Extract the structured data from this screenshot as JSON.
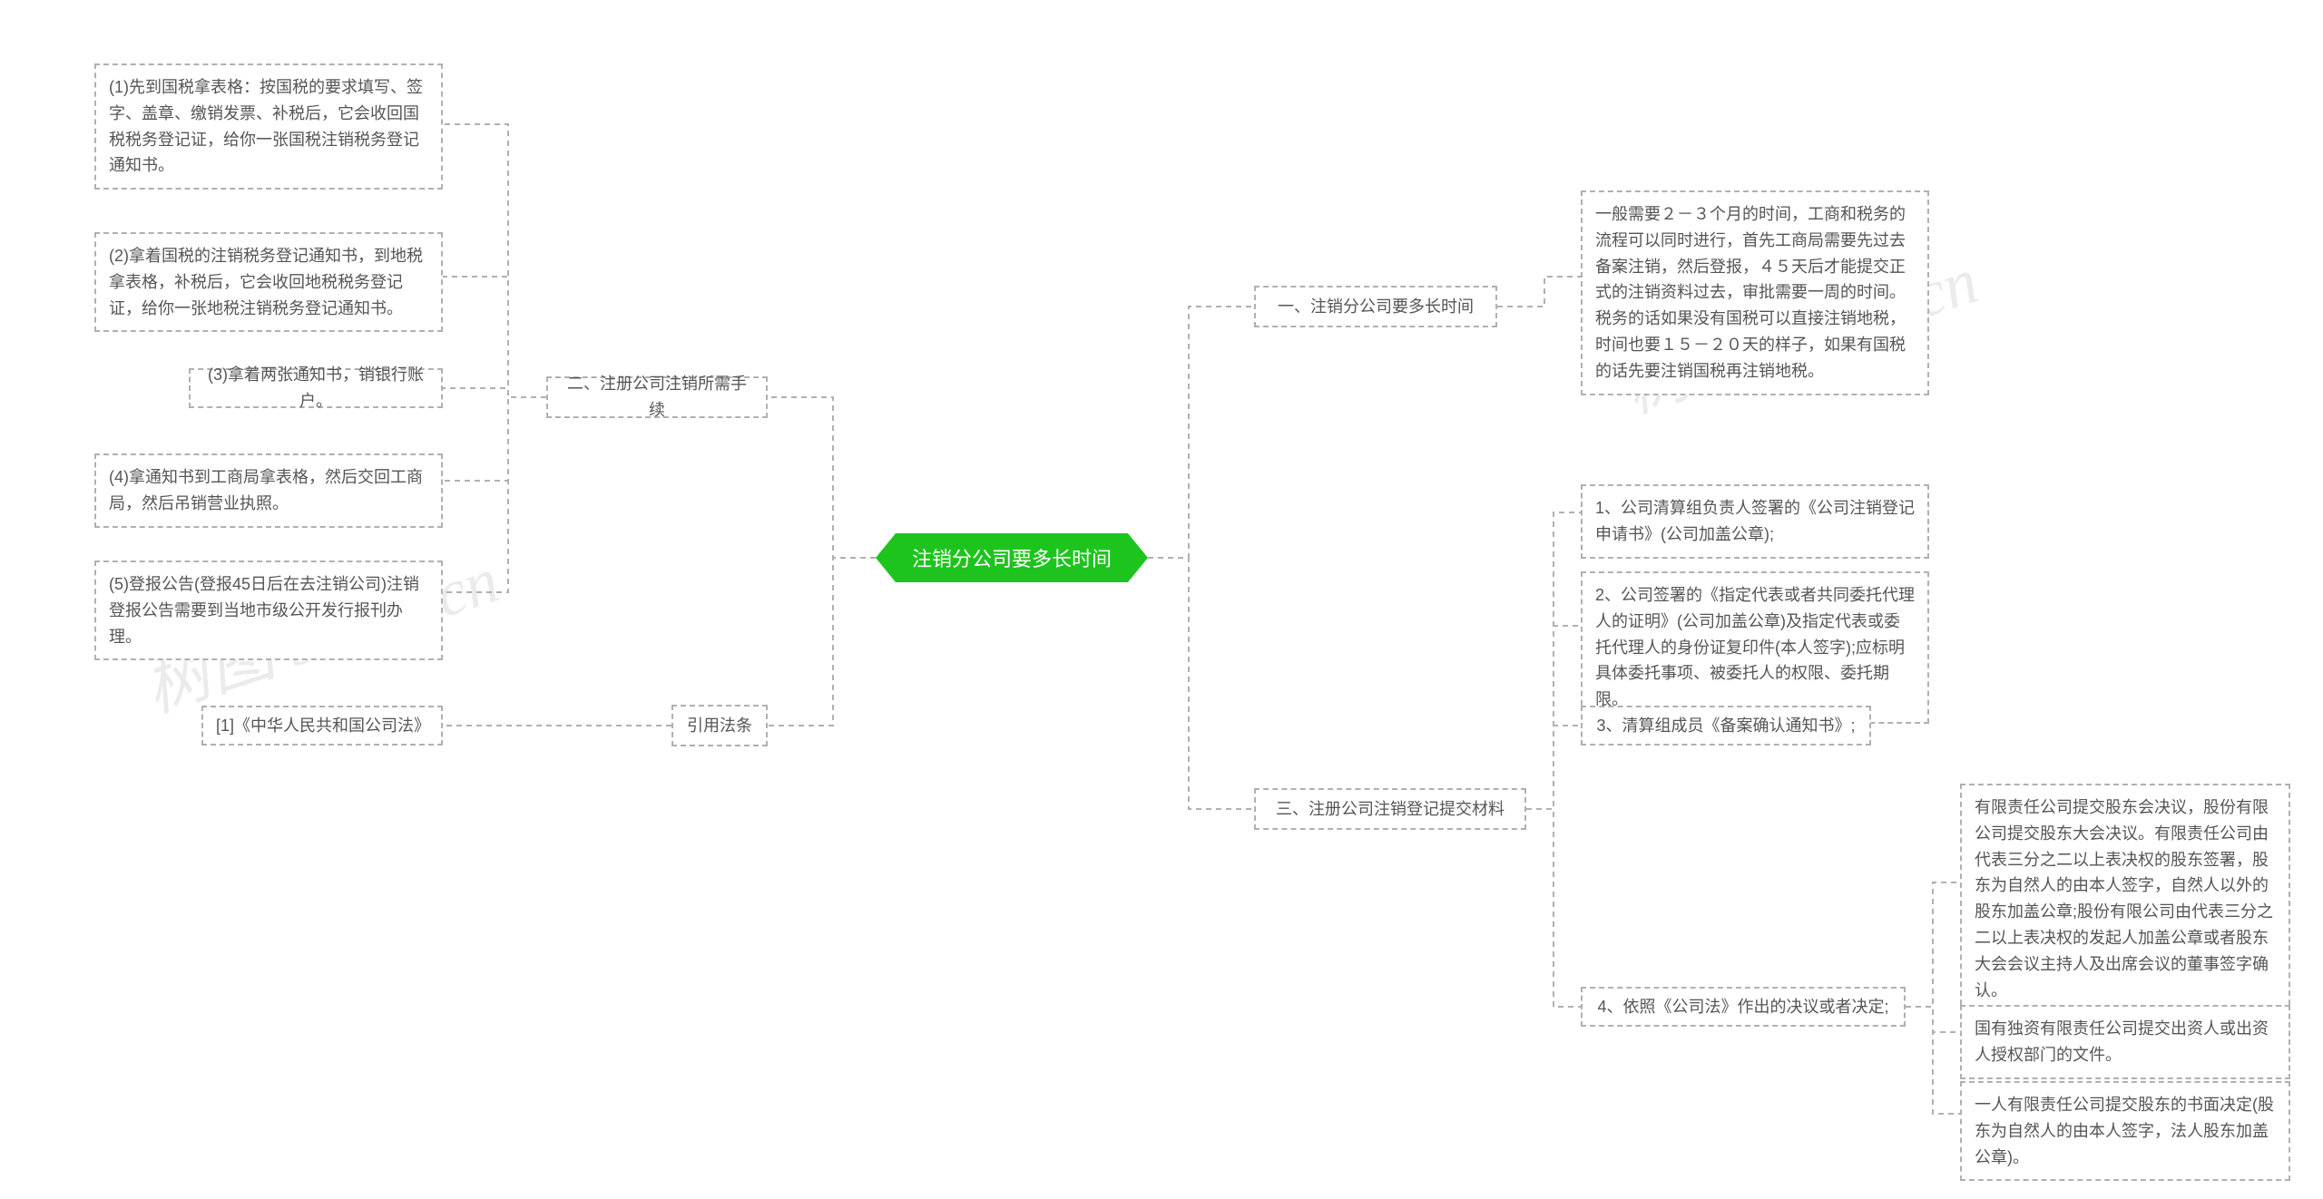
{
  "root": "注销分公司要多长时间",
  "watermark_left": "树图 shutu.cn",
  "watermark_right": "树图 shutu.cn",
  "right": {
    "b1": {
      "title": "一、注销分公司要多长时间",
      "c1": "一般需要２－３个月的时间，工商和税务的流程可以同时进行，首先工商局需要先过去备案注销，然后登报，４５天后才能提交正式的注销资料过去，审批需要一周的时间。税务的话如果没有国税可以直接注销地税，时间也要１５－２０天的样子，如果有国税的话先要注销国税再注销地税。"
    },
    "b3": {
      "title": "三、注册公司注销登记提交材料",
      "c1": "1、公司清算组负责人签署的《公司注销登记申请书》(公司加盖公章);",
      "c2": "2、公司签署的《指定代表或者共同委托代理人的证明》(公司加盖公章)及指定代表或委托代理人的身份证复印件(本人签字);应标明具体委托事项、被委托人的权限、委托期限。",
      "c3": "3、清算组成员《备案确认通知书》;",
      "c4": {
        "title": "4、依照《公司法》作出的决议或者决定;",
        "g1": "有限责任公司提交股东会决议，股份有限公司提交股东大会决议。有限责任公司由代表三分之二以上表决权的股东签署，股东为自然人的由本人签字，自然人以外的股东加盖公章;股份有限公司由代表三分之二以上表决权的发起人加盖公章或者股东大会会议主持人及出席会议的董事签字确认。",
        "g2": "国有独资有限责任公司提交出资人或出资人授权部门的文件。",
        "g3": "一人有限责任公司提交股东的书面决定(股东为自然人的由本人签字，法人股东加盖公章)。"
      }
    }
  },
  "left": {
    "b2": {
      "title": "二、注册公司注销所需手续",
      "c1": "(1)先到国税拿表格：按国税的要求填写、签字、盖章、缴销发票、补税后，它会收回国税税务登记证，给你一张国税注销税务登记通知书。",
      "c2": "(2)拿着国税的注销税务登记通知书，到地税拿表格，补税后，它会收回地税税务登记证，给你一张地税注销税务登记通知书。",
      "c3": "(3)拿着两张通知书，销银行账户。",
      "c4": "(4)拿通知书到工商局拿表格，然后交回工商局，然后吊销营业执照。",
      "c5": "(5)登报公告(登报45日后在去注销公司)注销登报公告需要到当地市级公开发行报刊办理。"
    },
    "law": {
      "title": "引用法条",
      "c1": "[1]《中华人民共和国公司法》"
    }
  }
}
